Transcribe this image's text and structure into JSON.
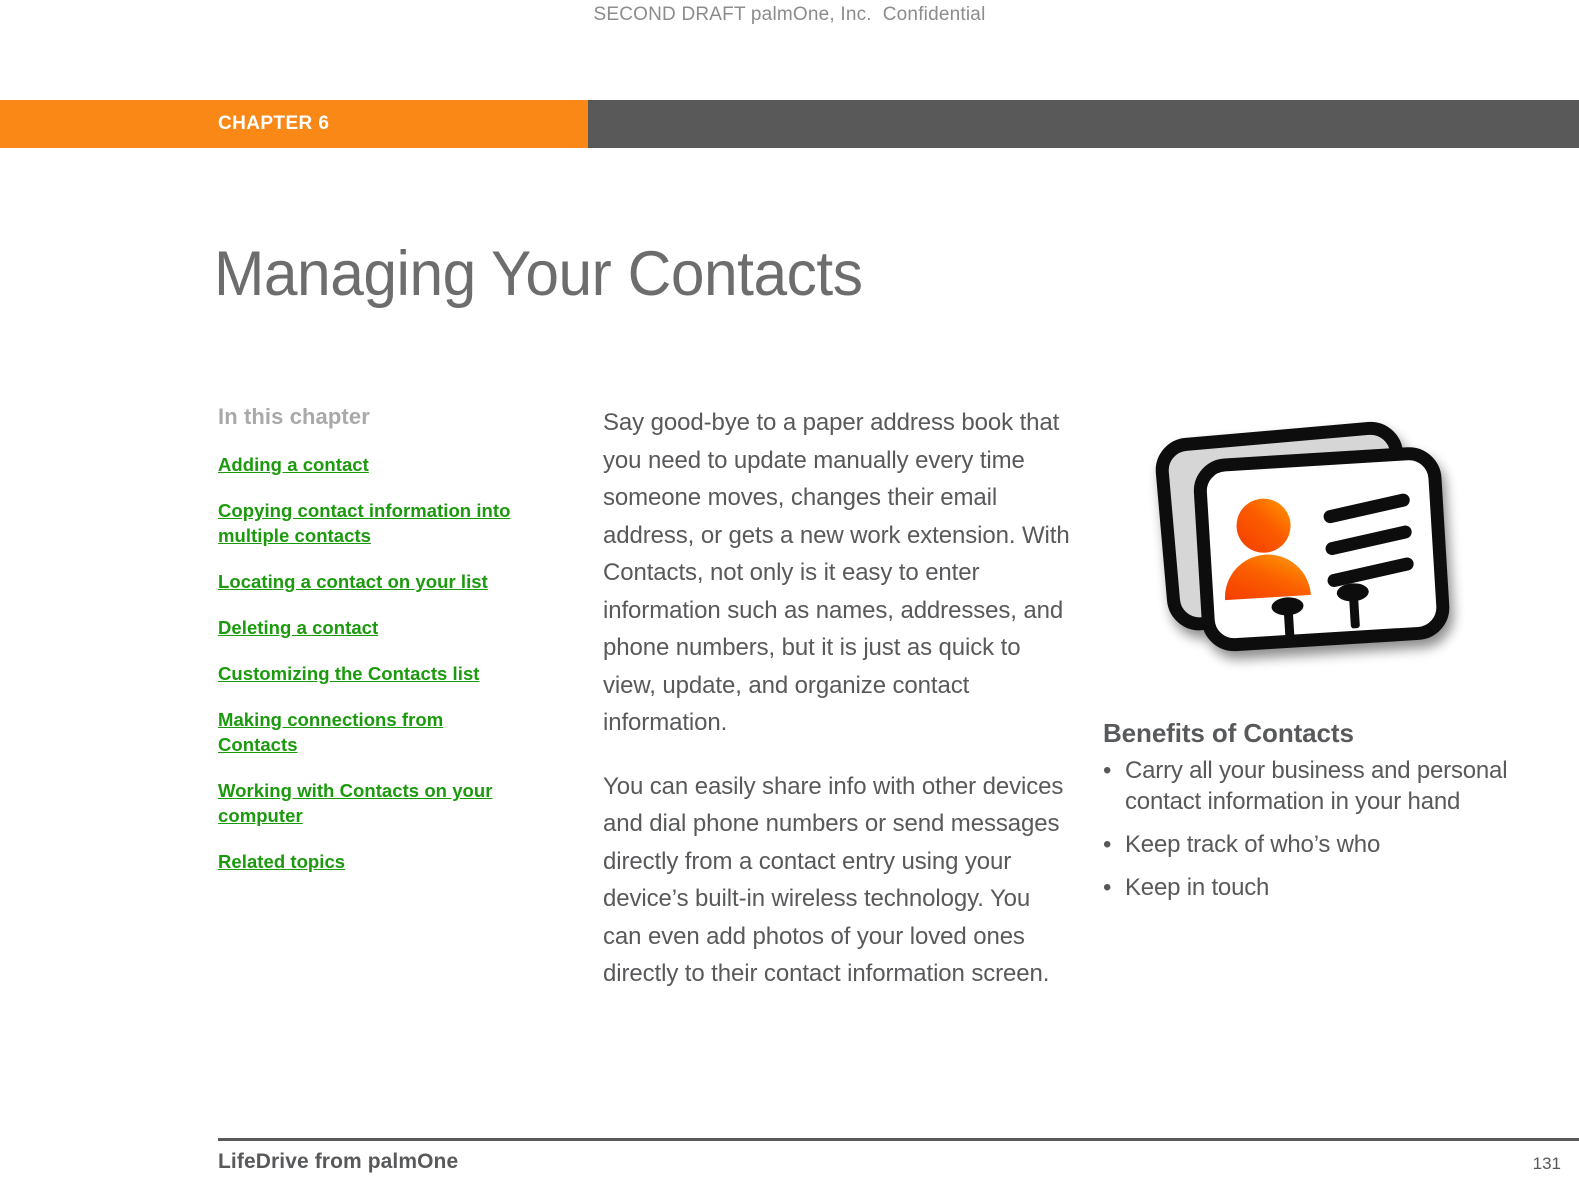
{
  "document": {
    "draft_header": "SECOND DRAFT palmOne, Inc.  Confidential",
    "chapter_label": "CHAPTER 6",
    "title": "Managing Your Contacts"
  },
  "colors": {
    "accent_orange": "#f98817",
    "bar_gray": "#595959",
    "link_green": "#1c9a0e",
    "text_gray": "#58595b",
    "muted_gray": "#a9a9a9",
    "title_gray": "#6d6d6d"
  },
  "sidebar": {
    "heading": "In this chapter",
    "links": [
      {
        "label": "Adding a contact"
      },
      {
        "label": "Copying contact information into multiple contacts"
      },
      {
        "label": "Locating a contact on your list"
      },
      {
        "label": "Deleting a contact"
      },
      {
        "label": "Customizing the Contacts list"
      },
      {
        "label": "Making connections from Contacts"
      },
      {
        "label": "Working with Contacts on your computer"
      },
      {
        "label": "Related topics"
      }
    ]
  },
  "main": {
    "paragraphs": [
      "Say good-bye to a paper address book that you need to update manually every time someone moves, changes their email address, or gets a new work extension. With Contacts, not only is it easy to enter information such as names, addresses, and phone numbers, but it is just as quick to view, update, and organize contact information.",
      "You can easily share info with other devices and dial phone numbers or send messages directly from a contact entry using your device’s built-in wireless technology. You can even add photos of your loved ones directly to their contact information screen."
    ]
  },
  "aside": {
    "illustration_name": "contact-cards-illustration",
    "benefits_title": "Benefits of Contacts",
    "bullet_char": "•",
    "benefits": [
      "Carry all your business and personal contact information in your hand",
      "Keep track of who’s who",
      "Keep in touch"
    ]
  },
  "footer": {
    "left": "LifeDrive from palmOne",
    "page_number": "131"
  }
}
